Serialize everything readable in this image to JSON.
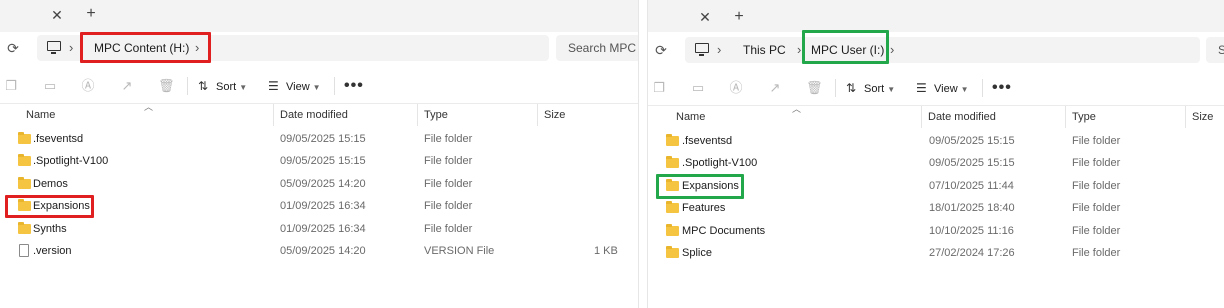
{
  "left": {
    "tab": {
      "close_glyph": "✕",
      "new_tab_glyph": "+"
    },
    "address": {
      "crumbs": [
        "MPC Content (H:)"
      ],
      "search_placeholder": "Search MPC Co",
      "highlight_color": "#e02020"
    },
    "toolbar": {
      "sort_label": "Sort",
      "view_label": "View",
      "more_glyph": "•••"
    },
    "columns": [
      "Name",
      "Date modified",
      "Type",
      "Size"
    ],
    "rows": [
      {
        "name": ".fseventsd",
        "date": "09/05/2025 15:15",
        "type": "File folder",
        "size": "",
        "icon": "folder-icon"
      },
      {
        "name": ".Spotlight-V100",
        "date": "09/05/2025 15:15",
        "type": "File folder",
        "size": "",
        "icon": "folder-icon"
      },
      {
        "name": "Demos",
        "date": "05/09/2025 14:20",
        "type": "File folder",
        "size": "",
        "icon": "folder-icon"
      },
      {
        "name": "Expansions",
        "date": "01/09/2025 16:34",
        "type": "File folder",
        "size": "",
        "icon": "folder-icon",
        "highlighted": true
      },
      {
        "name": "Synths",
        "date": "01/09/2025 16:34",
        "type": "File folder",
        "size": "",
        "icon": "folder-icon"
      },
      {
        "name": ".version",
        "date": "05/09/2025 14:20",
        "type": "VERSION File",
        "size": "1 KB",
        "icon": "file-icon"
      }
    ]
  },
  "right": {
    "tab": {
      "close_glyph": "✕",
      "new_tab_glyph": "+"
    },
    "address": {
      "crumbs": [
        "This PC",
        "MPC User (I:)"
      ],
      "search_placeholder": "S",
      "highlight_color": "#22a84a"
    },
    "toolbar": {
      "sort_label": "Sort",
      "view_label": "View",
      "more_glyph": "•••"
    },
    "columns": [
      "Name",
      "Date modified",
      "Type",
      "Size"
    ],
    "rows": [
      {
        "name": ".fseventsd",
        "date": "09/05/2025 15:15",
        "type": "File folder",
        "icon": "folder-icon"
      },
      {
        "name": ".Spotlight-V100",
        "date": "09/05/2025 15:15",
        "type": "File folder",
        "icon": "folder-icon"
      },
      {
        "name": "Expansions",
        "date": "07/10/2025 11:44",
        "type": "File folder",
        "icon": "folder-icon",
        "highlighted": true
      },
      {
        "name": "Features",
        "date": "18/01/2025 18:40",
        "type": "File folder",
        "icon": "folder-icon"
      },
      {
        "name": "MPC Documents",
        "date": "10/10/2025 11:16",
        "type": "File folder",
        "icon": "folder-icon"
      },
      {
        "name": "Splice",
        "date": "27/02/2024 17:26",
        "type": "File folder",
        "icon": "folder-icon"
      }
    ]
  }
}
